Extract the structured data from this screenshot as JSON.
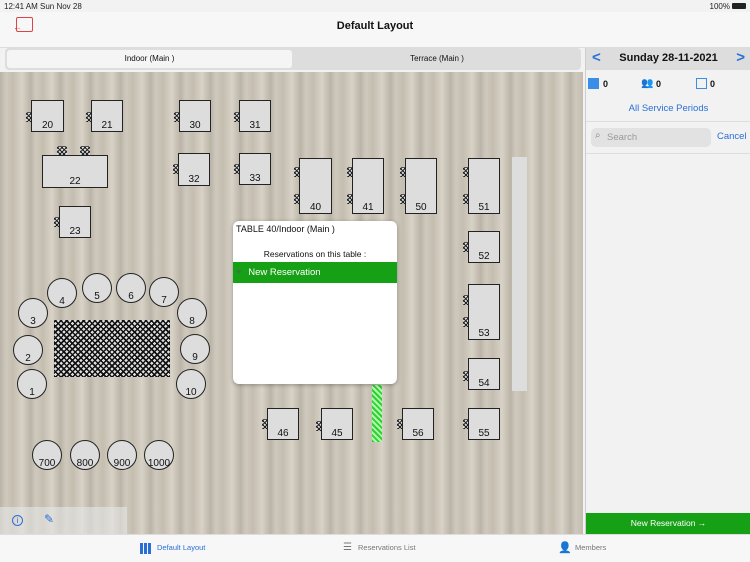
{
  "status": {
    "time": "12:41 AM",
    "date": "Sun Nov 28",
    "battery": "100%"
  },
  "nav": {
    "title": "Default Layout"
  },
  "tabs": [
    "Indoor (Main )",
    "Terrace (Main )"
  ],
  "tables": {
    "square": [
      "20",
      "21",
      "30",
      "31",
      "22",
      "32",
      "33",
      "23",
      "40",
      "41",
      "50",
      "51",
      "52",
      "53",
      "54",
      "55",
      "56",
      "45",
      "46"
    ],
    "round": [
      "1",
      "2",
      "3",
      "4",
      "5",
      "6",
      "7",
      "8",
      "9",
      "10",
      "700",
      "800",
      "900",
      "1000"
    ]
  },
  "popover": {
    "title": "TABLE 40/Indoor (Main )",
    "subtitle": "Reservations on this table :",
    "new_label": "New Reservation"
  },
  "right": {
    "date": "Sunday 28-11-2021",
    "prev": "<",
    "next": ">",
    "counts": [
      "0",
      "0",
      "0"
    ],
    "service": "All Service Periods",
    "search_placeholder": "Search",
    "cancel": "Cancel",
    "new_button": "New Reservation →"
  },
  "bottom": {
    "tabs": [
      "Default Layout",
      "Reservations List",
      "Members"
    ]
  },
  "colors": {
    "accent": "#2a6fd6",
    "green": "#16a016"
  }
}
